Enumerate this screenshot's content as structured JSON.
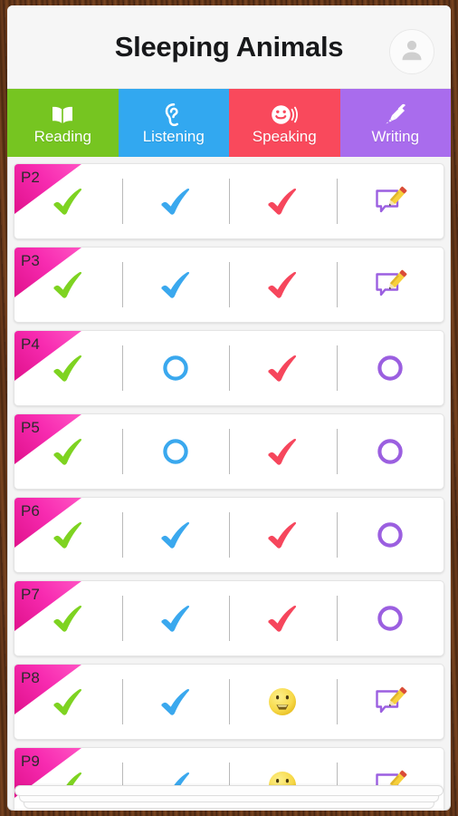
{
  "header": {
    "title": "Sleeping Animals",
    "avatar_icon": "person-avatar-icon"
  },
  "tabs": [
    {
      "label": "Reading",
      "icon": "open-book-icon",
      "color": "#76c521"
    },
    {
      "label": "Listening",
      "icon": "ear-icon",
      "color": "#32a8f0"
    },
    {
      "label": "Speaking",
      "icon": "smiley-speaking-icon",
      "color": "#f9495c"
    },
    {
      "label": "Writing",
      "icon": "fountain-pen-icon",
      "color": "#a96ced"
    }
  ],
  "colors": {
    "reading_mark": "#7ed321",
    "listening_mark": "#3aa8ee",
    "speaking_mark": "#f6465c",
    "writing_mark": "#9b5fe0",
    "corner_flag": "#f0189c",
    "emoji_face": "#f7d948",
    "pencil_body": "#f7d03c",
    "pencil_eraser": "#d94b3a",
    "frame_wood": "#5b3117"
  },
  "columns": [
    "Reading",
    "Listening",
    "Speaking",
    "Writing"
  ],
  "rows": [
    {
      "label": "P2",
      "marks": [
        "check",
        "check",
        "check",
        "note"
      ]
    },
    {
      "label": "P3",
      "marks": [
        "check",
        "check",
        "check",
        "note"
      ]
    },
    {
      "label": "P4",
      "marks": [
        "check",
        "circle",
        "check",
        "circle"
      ]
    },
    {
      "label": "P5",
      "marks": [
        "check",
        "circle",
        "check",
        "circle"
      ]
    },
    {
      "label": "P6",
      "marks": [
        "check",
        "check",
        "check",
        "circle"
      ]
    },
    {
      "label": "P7",
      "marks": [
        "check",
        "check",
        "check",
        "circle"
      ]
    },
    {
      "label": "P8",
      "marks": [
        "check",
        "check",
        "emoji",
        "note"
      ]
    },
    {
      "label": "P9",
      "marks": [
        "check",
        "check",
        "emoji",
        "note"
      ]
    }
  ]
}
